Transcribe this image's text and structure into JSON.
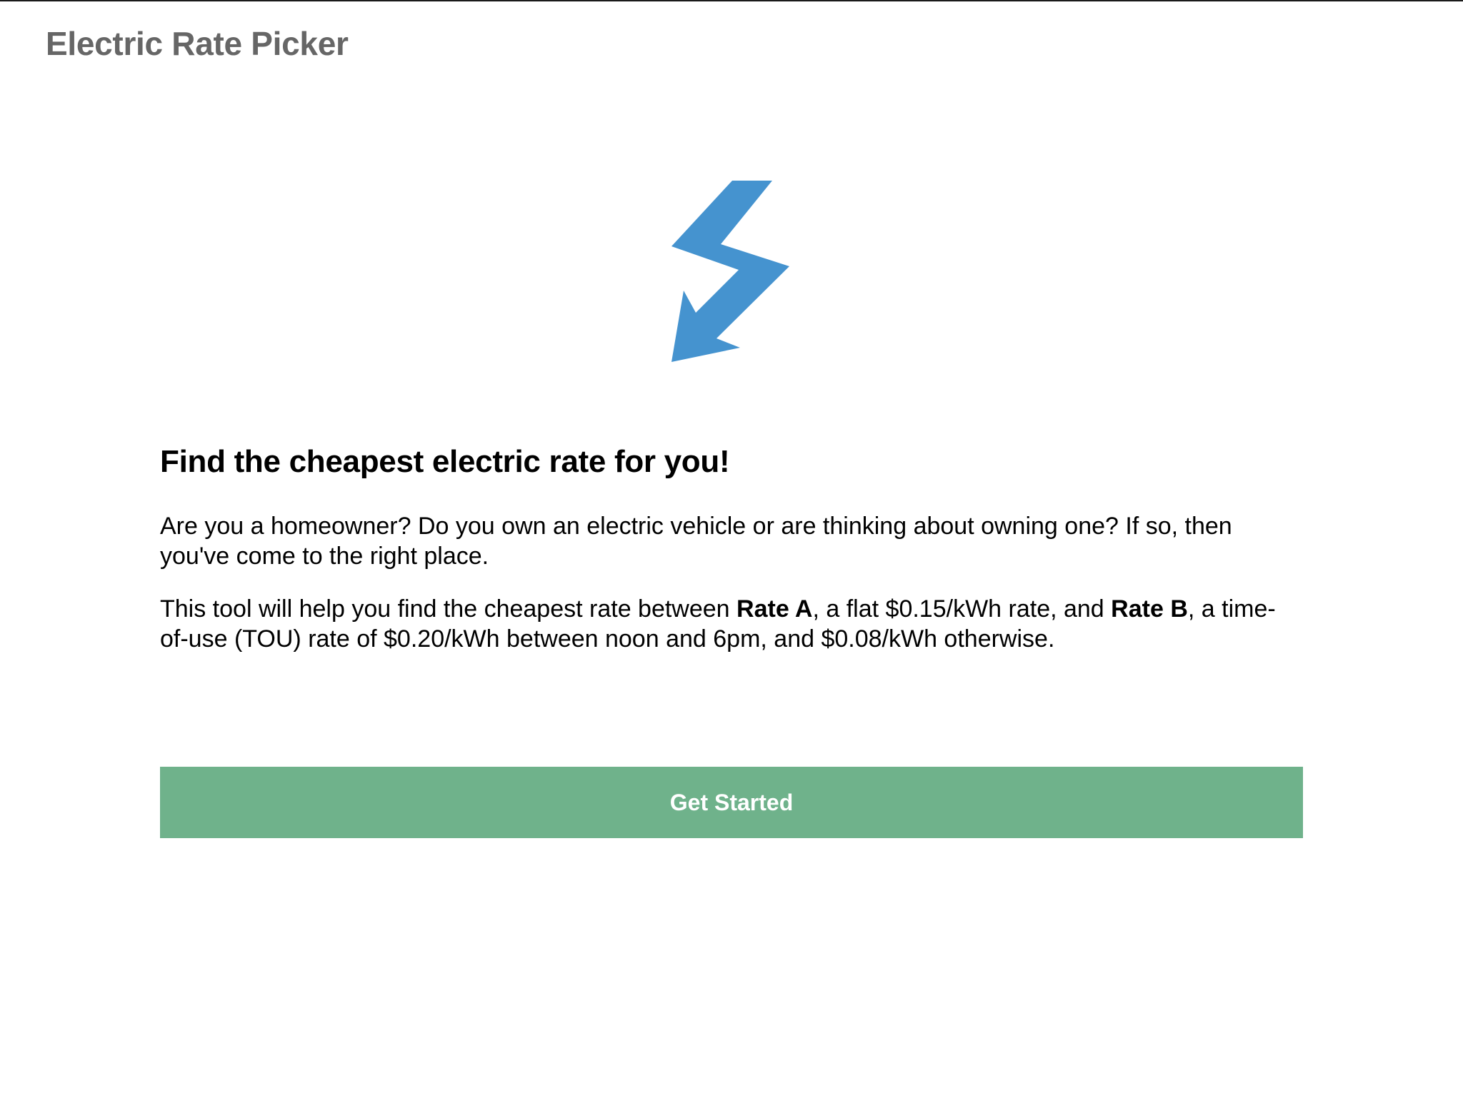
{
  "header": {
    "app_title": "Electric Rate Picker"
  },
  "logo": {
    "icon": "lightning-bolt-icon",
    "color": "#4593cf"
  },
  "main": {
    "headline": "Find the cheapest electric rate for you!",
    "intro": "Are you a homeowner? Do you own an electric vehicle or are thinking about owning one? If so, then you've come to the right place.",
    "rates": {
      "lead": "This tool will help you find the cheapest rate between ",
      "rate_a_label": "Rate A",
      "rate_a_text": ", a flat $0.15/kWh rate, and ",
      "rate_b_label": "Rate B",
      "rate_b_text": ", a time-of-use (TOU) rate of $0.20/kWh between noon and 6pm, and $0.08/kWh otherwise."
    },
    "cta_label": "Get Started",
    "cta_color": "#6fb28b"
  }
}
